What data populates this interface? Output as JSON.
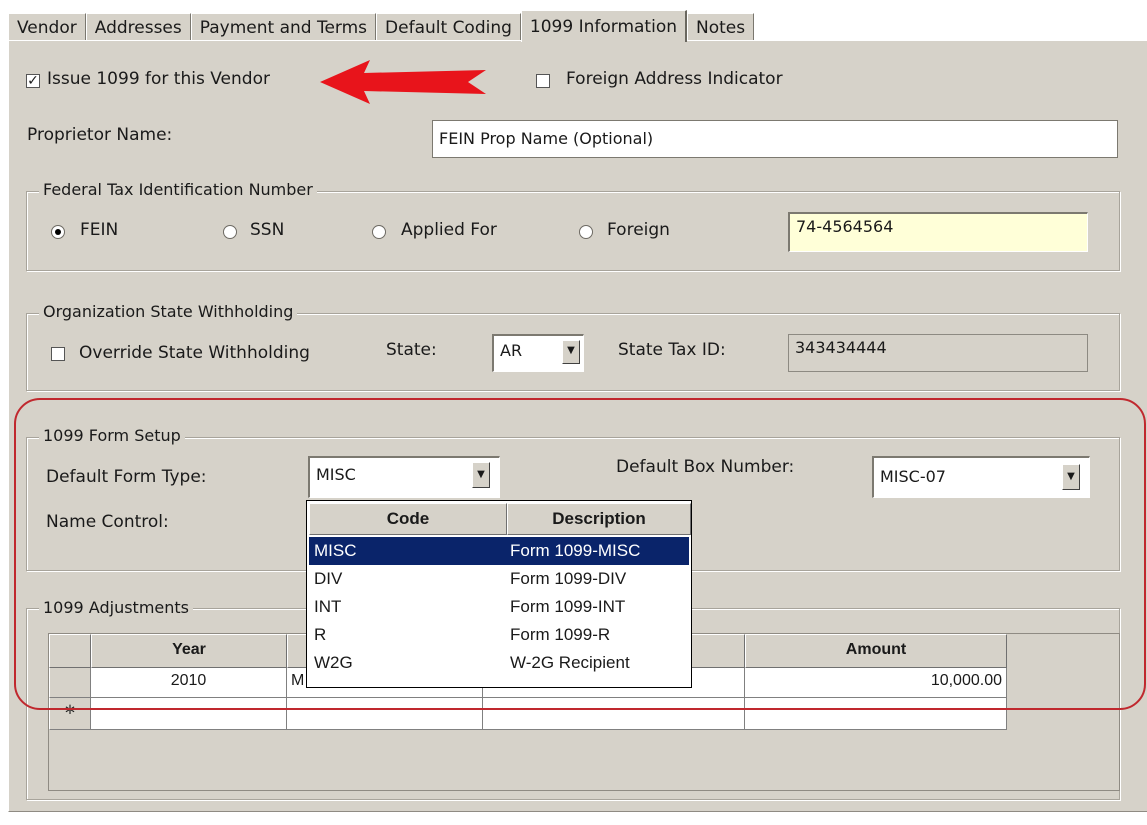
{
  "tabs": [
    "Vendor",
    "Addresses",
    "Payment and Terms",
    "Default Coding",
    "1099 Information",
    "Notes"
  ],
  "active_tab": "1099 Information",
  "issue_1099": {
    "label": "Issue 1099 for this Vendor",
    "checked": true
  },
  "foreign_address": {
    "label": "Foreign Address Indicator",
    "checked": false
  },
  "proprietor": {
    "label": "Proprietor Name:",
    "value": "FEIN Prop Name (Optional)"
  },
  "tax_id": {
    "legend": "Federal Tax Identification Number",
    "options": [
      "FEIN",
      "SSN",
      "Applied For",
      "Foreign"
    ],
    "selected": "FEIN",
    "value": "74-4564564"
  },
  "state_withholding": {
    "legend": "Organization State Withholding",
    "override_label": "Override State Withholding",
    "override_checked": false,
    "state_label": "State:",
    "state_value": "AR",
    "tax_id_label": "State Tax ID:",
    "tax_id_value": "343434444"
  },
  "form_setup": {
    "legend": "1099 Form Setup",
    "form_type_label": "Default Form Type:",
    "form_type_value": "MISC",
    "box_label": "Default Box Number:",
    "box_value": "MISC-07",
    "name_control_label": "Name Control:"
  },
  "form_type_dropdown": {
    "headers": [
      "Code",
      "Description"
    ],
    "rows": [
      [
        "MISC",
        "Form 1099-MISC"
      ],
      [
        "DIV",
        "Form 1099-DIV"
      ],
      [
        "INT",
        "Form 1099-INT"
      ],
      [
        "R",
        "Form 1099-R"
      ],
      [
        "W2G",
        "W-2G Recipient"
      ]
    ],
    "selected_index": 0
  },
  "adjustments": {
    "legend": "1099 Adjustments",
    "headers": [
      "Year",
      "",
      "",
      "Amount"
    ],
    "rows": [
      [
        "2010",
        "M",
        "",
        "10,000.00"
      ]
    ],
    "new_row_marker": "*"
  },
  "colors": {
    "highlight": "#0a246a",
    "annotation_red": "#e8141b",
    "panel": "#d6d2c9"
  },
  "icons": [
    "dropdown-arrow-icon",
    "red-arrow-icon",
    "checkmark-icon"
  ]
}
